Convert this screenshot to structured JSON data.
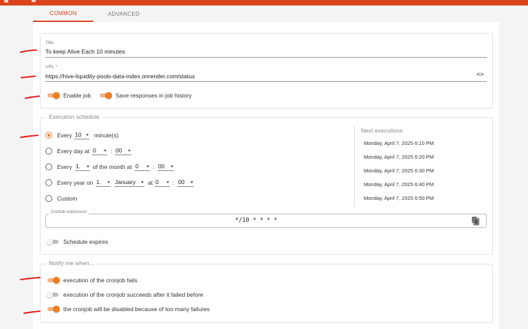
{
  "tabs": [
    {
      "label": "COMMON",
      "active": true
    },
    {
      "label": "ADVANCED",
      "active": false
    }
  ],
  "job": {
    "title_label": "Title",
    "title_value": "To keep Alive Each 10 minutes",
    "url_label": "URL *",
    "url_value": "https://hive-liquidity-pools-data-index.onrender.com/status",
    "url_icon": "code-brackets-icon",
    "enable_job": {
      "label": "Enable job",
      "on": true
    },
    "save_responses": {
      "label": "Save responses in job history",
      "on": true
    }
  },
  "schedule": {
    "legend": "Execution schedule",
    "every": {
      "prefix": "Every",
      "value": "10",
      "suffix": "minute(s)"
    },
    "every_day": {
      "prefix": "Every day at",
      "hour": "0",
      "colon": ":",
      "minute": "00"
    },
    "every_month": {
      "prefix": "Every",
      "day": "1.",
      "middle": "of the month at",
      "hour": "0",
      "colon": ":",
      "minute": "00"
    },
    "every_year": {
      "prefix": "Every year on",
      "day": "1.",
      "month": "January",
      "at": "at",
      "hour": "0",
      "colon": ":",
      "minute": "00"
    },
    "custom": {
      "label": "Custom"
    },
    "selected": "every",
    "next_executions": {
      "title": "Next executions",
      "items": [
        "Monday, April 7, 2025 6:10 PM",
        "Monday, April 7, 2025 6:20 PM",
        "Monday, April 7, 2025 6:30 PM",
        "Monday, April 7, 2025 6:40 PM",
        "Monday, April 7, 2025 6:50 PM"
      ]
    },
    "crontab": {
      "label": "Crontab expression",
      "value": "*/10 * * * *",
      "icon": "copy-icon"
    },
    "expires": {
      "label": "Schedule expires",
      "on": false
    }
  },
  "notify": {
    "legend": "Notify me when...",
    "items": [
      {
        "label": "execution of the cronjob fails",
        "on": true
      },
      {
        "label": "execution of the cronjob succeeds after it failed before",
        "on": false
      },
      {
        "label": "the cronjob will be disabled because of too many failures",
        "on": true
      }
    ]
  },
  "colors": {
    "header": "#d9441c",
    "accent": "#ef7d22",
    "annotation": "#e0201f"
  }
}
